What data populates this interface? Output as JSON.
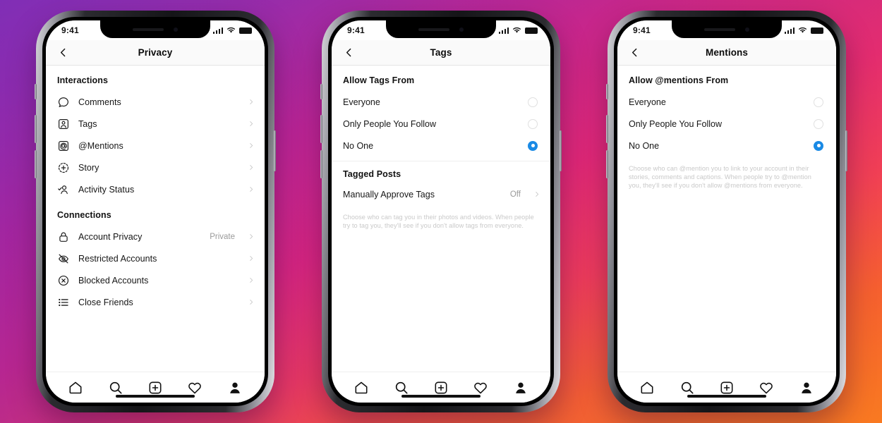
{
  "status_bar": {
    "time": "9:41",
    "signal_icon": "cellular-bars-icon",
    "wifi_icon": "wifi-icon",
    "battery_icon": "battery-icon"
  },
  "tab_bar": {
    "items": [
      {
        "name": "home-tab",
        "icon": "home-icon"
      },
      {
        "name": "search-tab",
        "icon": "search-icon"
      },
      {
        "name": "create-tab",
        "icon": "plus-square-icon"
      },
      {
        "name": "activity-tab",
        "icon": "heart-icon"
      },
      {
        "name": "profile-tab",
        "icon": "person-filled-icon"
      }
    ]
  },
  "phones": [
    {
      "id": "privacy-screen",
      "nav": {
        "title": "Privacy",
        "back_icon": "chevron-left-icon"
      },
      "sections": [
        {
          "heading": "Interactions",
          "rows": [
            {
              "label": "Comments",
              "icon": "comment-bubble-icon",
              "value": ""
            },
            {
              "label": "Tags",
              "icon": "tag-person-icon",
              "value": ""
            },
            {
              "label": "@Mentions",
              "icon": "at-mention-icon",
              "value": ""
            },
            {
              "label": "Story",
              "icon": "story-plus-icon",
              "value": ""
            },
            {
              "label": "Activity Status",
              "icon": "person-check-icon",
              "value": ""
            }
          ]
        },
        {
          "heading": "Connections",
          "rows": [
            {
              "label": "Account Privacy",
              "icon": "lock-icon",
              "value": "Private"
            },
            {
              "label": "Restricted Accounts",
              "icon": "eye-slash-icon",
              "value": ""
            },
            {
              "label": "Blocked Accounts",
              "icon": "circle-x-icon",
              "value": ""
            },
            {
              "label": "Close Friends",
              "icon": "list-star-icon",
              "value": ""
            }
          ]
        }
      ]
    },
    {
      "id": "tags-screen",
      "nav": {
        "title": "Tags",
        "back_icon": "chevron-left-icon"
      },
      "group_heading": "Allow Tags From",
      "options": [
        {
          "label": "Everyone",
          "selected": false
        },
        {
          "label": "Only People You Follow",
          "selected": false
        },
        {
          "label": "No One",
          "selected": true
        }
      ],
      "sub_heading": "Tagged Posts",
      "sub_row": {
        "label": "Manually Approve Tags",
        "value": "Off",
        "chevron_icon": "chevron-right-icon"
      },
      "helper_text": "Choose who can tag you in their photos and videos. When people try to tag you, they'll see if you don't allow tags from everyone."
    },
    {
      "id": "mentions-screen",
      "nav": {
        "title": "Mentions",
        "back_icon": "chevron-left-icon"
      },
      "group_heading": "Allow @mentions From",
      "options": [
        {
          "label": "Everyone",
          "selected": false
        },
        {
          "label": "Only People You Follow",
          "selected": false
        },
        {
          "label": "No One",
          "selected": true
        }
      ],
      "helper_text": "Choose who can @mention you to link to your account in their stories, comments and captions. When people try to @mention you, they'll see if you don't allow @mentions from everyone."
    }
  ],
  "colors": {
    "accent_blue": "#1a8ae5",
    "text_primary": "#161616",
    "text_muted": "#9a9a9a",
    "helper_grey": "#c9c9c9",
    "nav_bg": "#fafafa"
  }
}
